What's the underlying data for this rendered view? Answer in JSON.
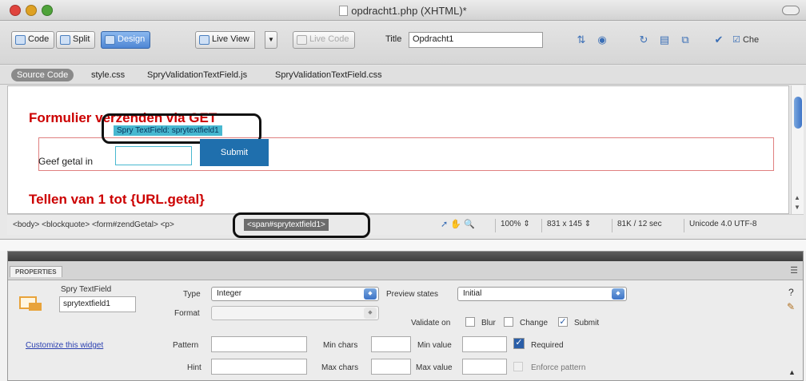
{
  "window": {
    "title": "opdracht1.php (XHTML)*"
  },
  "toolbar": {
    "code_label": "Code",
    "split_label": "Split",
    "design_label": "Design",
    "liveview_label": "Live View",
    "livecode_label": "Live Code",
    "title_label": "Title",
    "title_value": "Opdracht1",
    "check_label": "Che"
  },
  "related_files": {
    "source_label": "Source Code",
    "files": [
      "style.css",
      "SpryValidationTextField.js",
      "SpryValidationTextField.css"
    ]
  },
  "design": {
    "heading1": "Formulier verzenden via GET",
    "spry_tab": "Spry TextField: sprytextfield1",
    "field_label": "Geef getal in",
    "submit_label": "Submit",
    "heading2": "Tellen van 1 tot {URL.getal}"
  },
  "status": {
    "tags": "<body> <blockquote> <form#zendGetal> <p>",
    "selected_tag": "<span#sprytextfield1>",
    "zoom": "100%",
    "size": "831 x 145",
    "download": "81K / 12 sec",
    "encoding": "Unicode 4.0 UTF-8"
  },
  "properties": {
    "tab_label": "PROPERTIES",
    "widget_name": "Spry TextField",
    "widget_id": "sprytextfield1",
    "customize_link": "Customize this widget",
    "type_label": "Type",
    "type_value": "Integer",
    "format_label": "Format",
    "pattern_label": "Pattern",
    "hint_label": "Hint",
    "preview_label": "Preview states",
    "preview_value": "Initial",
    "validate_label": "Validate on",
    "blur_label": "Blur",
    "change_label": "Change",
    "submit_label": "Submit",
    "minchars_label": "Min chars",
    "maxchars_label": "Max chars",
    "minvalue_label": "Min value",
    "maxvalue_label": "Max value",
    "required_label": "Required",
    "enforce_label": "Enforce pattern",
    "blur_checked": false,
    "change_checked": false,
    "submit_checked": true,
    "required_checked": true,
    "enforce_checked": false
  },
  "colors": {
    "heading": "#cc0000",
    "accent": "#3d74c7",
    "spry": "#48b8d0"
  }
}
